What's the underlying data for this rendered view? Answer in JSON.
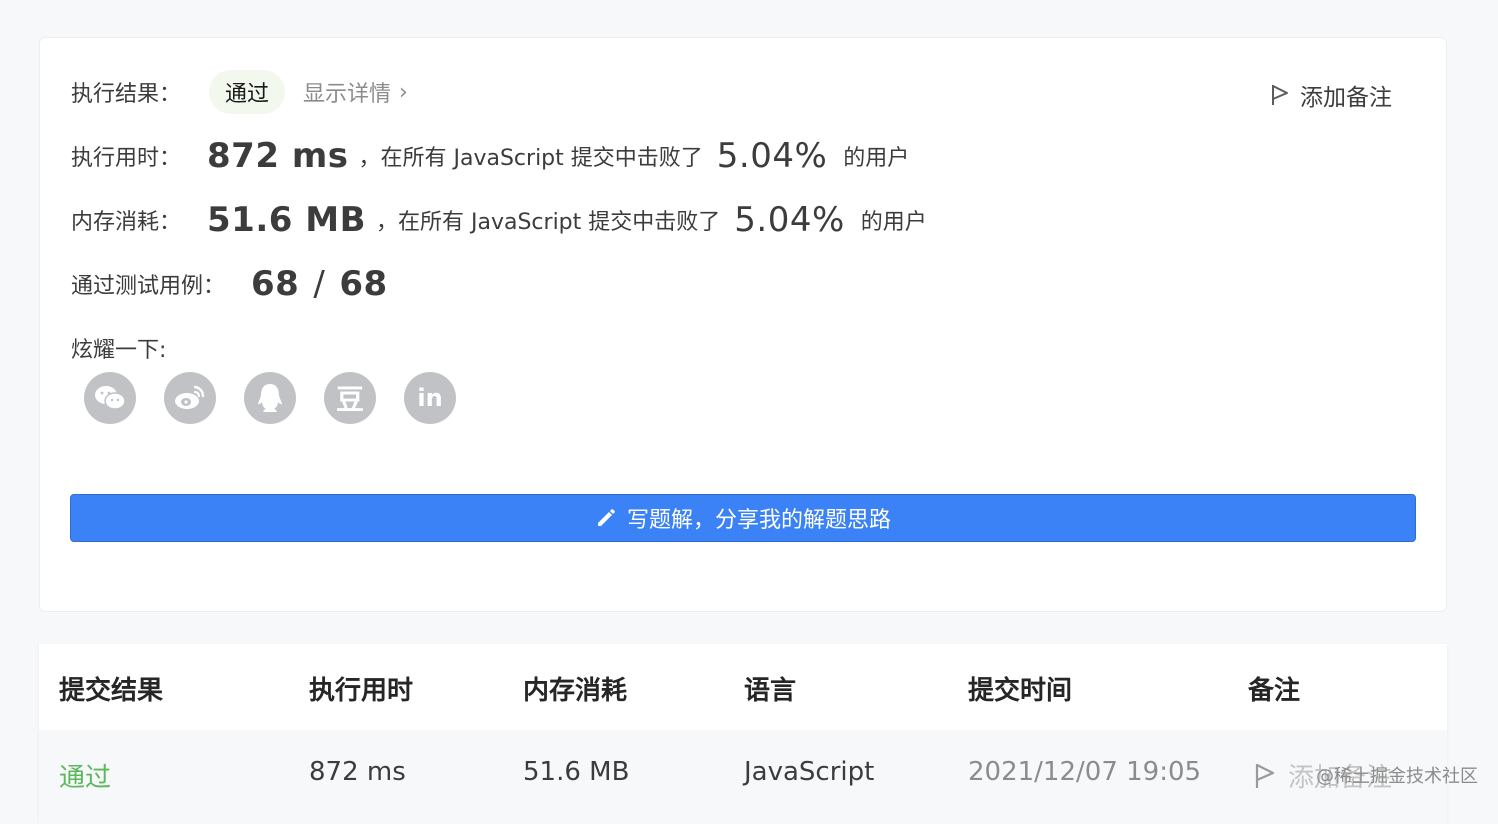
{
  "result": {
    "label": "执行结果：",
    "status": "通过",
    "details_link": "显示详情",
    "add_note": "添加备注"
  },
  "runtime": {
    "label": "执行用时：",
    "value": "872 ms",
    "beat_prefix": "，在所有 JavaScript 提交中击败了",
    "percent": "5.04%",
    "suffix": "的用户"
  },
  "memory": {
    "label": "内存消耗：",
    "value": "51.6 MB",
    "beat_prefix": "，在所有 JavaScript 提交中击败了",
    "percent": "5.04%",
    "suffix": "的用户"
  },
  "tests": {
    "label": "通过测试用例：",
    "passed": "68",
    "separator": "/",
    "total": "68"
  },
  "share": {
    "label": "炫耀一下:",
    "buttons": [
      "wechat-icon",
      "weibo-icon",
      "qq-icon",
      "douban-icon",
      "linkedin-icon"
    ],
    "linkedin_text": "in",
    "douban_text": "豆"
  },
  "cta": {
    "label": "写题解，分享我的解题思路"
  },
  "table": {
    "headers": [
      "提交结果",
      "执行用时",
      "内存消耗",
      "语言",
      "提交时间",
      "备注"
    ],
    "row": {
      "result": "通过",
      "runtime": "872 ms",
      "memory": "51.6 MB",
      "language": "JavaScript",
      "time": "2021/12/07 19:05",
      "note": "添加备注"
    }
  },
  "watermark": "@稀土掘金技术社区",
  "colors": {
    "accent": "#3b82f6",
    "success": "#5cb85c",
    "badge_bg": "#f3f8ef",
    "icon_gray": "#c0c2c6"
  }
}
